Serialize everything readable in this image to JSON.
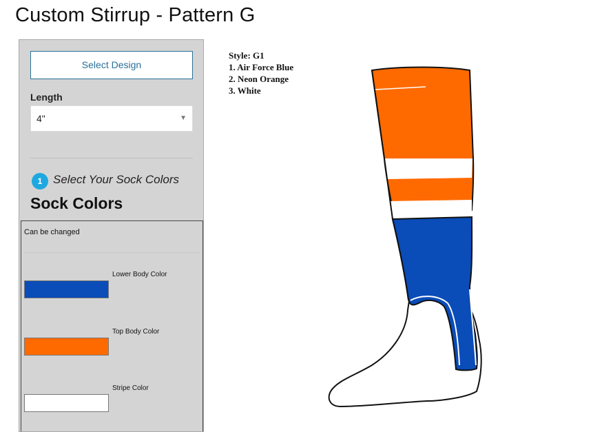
{
  "page": {
    "title": "Custom Stirrup - Pattern G"
  },
  "panel": {
    "select_design_label": "Select Design",
    "length_label": "Length",
    "length_value": "4\"",
    "step_number": "1",
    "step_label": "Select Your Sock Colors",
    "heading": "Sock Colors",
    "colors_box": {
      "note": "Can be changed",
      "items": [
        {
          "label": "Lower Body Color",
          "color": "#0a4cb8"
        },
        {
          "label": "Top Body Color",
          "color": "#ff6a00"
        },
        {
          "label": "Stripe Color",
          "color": "#ffffff"
        }
      ]
    }
  },
  "preview": {
    "style_line": "Style: G1",
    "colors": [
      "1. Air Force Blue",
      "2. Neon Orange",
      "3. White"
    ]
  },
  "colors": {
    "lower_body": "#0a4cb8",
    "top_body": "#ff6a00",
    "stripe": "#ffffff",
    "accent": "#1fa8e0",
    "link": "#2a6f97"
  }
}
